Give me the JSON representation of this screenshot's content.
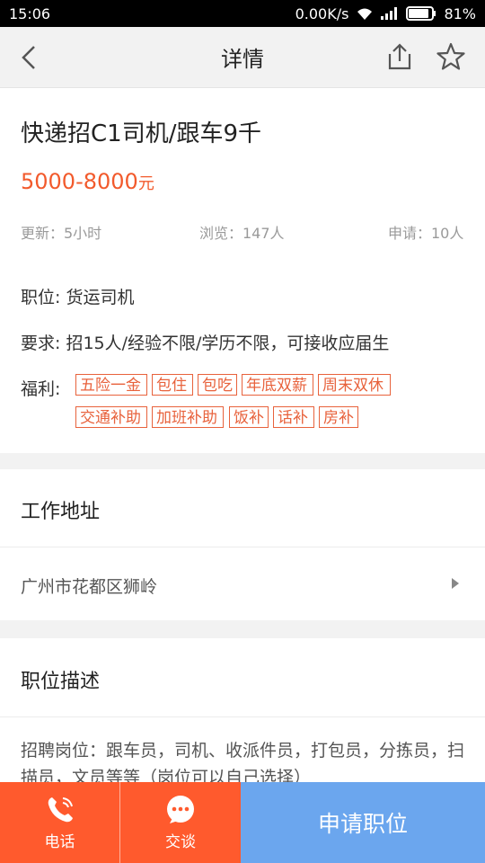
{
  "status_bar": {
    "time": "15:06",
    "speed": "0.00K/s",
    "battery": "81%"
  },
  "nav": {
    "title": "详情"
  },
  "job": {
    "title": "快递招C1司机/跟车9千",
    "salary": "5000-8000",
    "salary_unit": "元",
    "updated": "更新：5小时",
    "views": "浏览：147人",
    "applied": "申请：10人",
    "position_label": "职位:",
    "position_value": "货运司机",
    "requirement_label": "要求:",
    "requirement_value": "招15人/经验不限/学历不限，可接收应届生",
    "benefits_label": "福利:",
    "benefits": [
      "五险一金",
      "包住",
      "包吃",
      "年底双薪",
      "周末双休",
      "交通补助",
      "加班补助",
      "饭补",
      "话补",
      "房补"
    ]
  },
  "address": {
    "heading": "工作地址",
    "value": "广州市花都区狮岭"
  },
  "description": {
    "heading": "职位描述",
    "text": "招聘岗位：跟车员，司机、收派件员，打包员，分拣员，扫描员，文员等等（岗位可以自己选择）"
  },
  "bottom_bar": {
    "phone_label": "电话",
    "chat_label": "交谈",
    "apply_label": "申请职位"
  },
  "colors": {
    "accent": "#f25a2c",
    "apply": "#6ba6ee",
    "bottom_orange": "#ff5a2d"
  }
}
